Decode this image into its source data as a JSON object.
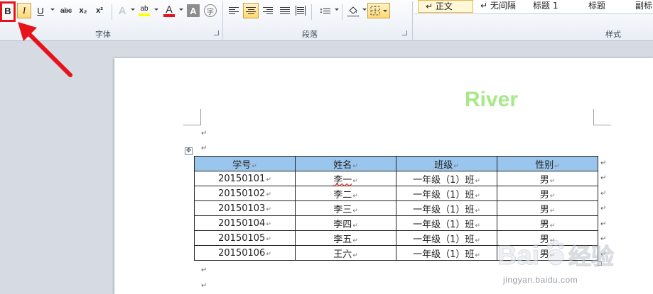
{
  "ribbon": {
    "font_group": {
      "label": "字体",
      "bold": "B",
      "italic": "I",
      "underline": "U",
      "strikethrough": "abc",
      "subscript": "x₂",
      "superscript": "x²",
      "text_effect": "A",
      "highlight": "ab",
      "font_color": "A",
      "char_shading": "A",
      "enclose_char": "字"
    },
    "paragraph_group": {
      "label": "段落"
    },
    "styles_group": {
      "label": "样式",
      "items": [
        "↵ 正文",
        "↵ 无间隔",
        "标题 1",
        "标题",
        "副标"
      ]
    }
  },
  "document": {
    "watermark_title": "River",
    "paragraph_mark": "↵",
    "table": {
      "headers": [
        "学号",
        "姓名",
        "班级",
        "性别"
      ],
      "rows": [
        [
          "20150101",
          "李一",
          "一年级（1）班",
          "男"
        ],
        [
          "20150102",
          "李二",
          "一年级（1）班",
          "男"
        ],
        [
          "20150103",
          "李三",
          "一年级（1）班",
          "男"
        ],
        [
          "20150104",
          "李四",
          "一年级（1）班",
          "男"
        ],
        [
          "20150105",
          "李五",
          "一年级（1）班",
          "男"
        ],
        [
          "20150106",
          "王六",
          "一年级（1）班",
          "男"
        ]
      ]
    }
  },
  "overlay": {
    "baidu_logo": "Bai 经验",
    "baidu_url": "jingyan.baidu.com"
  },
  "colors": {
    "highlight_box": "#e8131a",
    "arrow": "#e8131a",
    "header_fill": "#9ac6ee",
    "title_green": "#a7e889"
  },
  "icons": [
    "align-left-icon",
    "align-center-icon",
    "align-right-icon",
    "justify-icon",
    "distributed-icon",
    "line-spacing-icon",
    "shading-icon",
    "borders-icon",
    "table-move-icon"
  ]
}
